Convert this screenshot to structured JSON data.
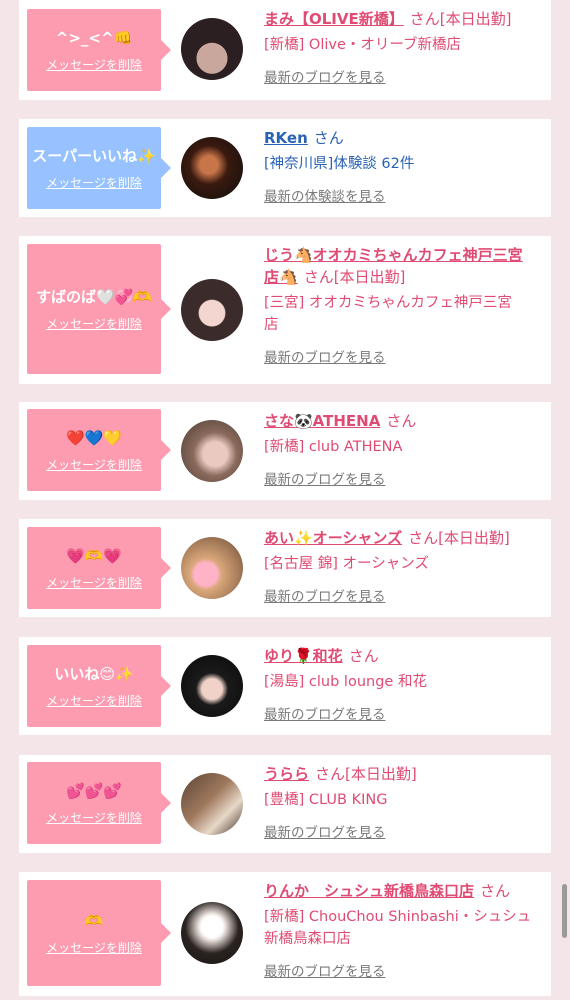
{
  "items": [
    {
      "bubble_text": "^>_<^👊",
      "delete_label": "メッセージを削除",
      "name": "まみ【OLIVE新橋】",
      "suffix": "さん[本日出勤]",
      "shop": "[新橋] Olive・オリーブ新橋店",
      "blog": "最新のブログを見る",
      "bubble_color": "#fd9cb0"
    },
    {
      "bubble_text": "スーパーいいね✨",
      "delete_label": "メッセージを削除",
      "name": "RKen",
      "suffix": "さん",
      "shop": "[神奈川県]体験談 62件",
      "blog": "最新の体験談を見る",
      "bubble_color": "#97c2ff"
    },
    {
      "bubble_text": "すばのば🤍💞🫶",
      "delete_label": "メッセージを削除",
      "name_line1": "じう🐴オオカミちゃんカフェ神戸三宮",
      "name_line2": "店🐴",
      "suffix": "さん[本日出勤]",
      "shop_line1": "[三宮] オオカミちゃんカフェ神戸三宮",
      "shop_line2": "店",
      "blog": "最新のブログを見る",
      "bubble_color": "#fd9cb0"
    },
    {
      "bubble_text": "❤️💙💛",
      "delete_label": "メッセージを削除",
      "name": "さな🐼ATHENA",
      "suffix": "さん",
      "shop": "[新橋] club ATHENA",
      "blog": "最新のブログを見る",
      "bubble_color": "#fd9cb0"
    },
    {
      "bubble_text": "💗🫶💗",
      "delete_label": "メッセージを削除",
      "name": "あい✨オーシャンズ",
      "suffix": "さん[本日出勤]",
      "shop": "[名古屋 錦] オーシャンズ",
      "blog": "最新のブログを見る",
      "bubble_color": "#fd9cb0"
    },
    {
      "bubble_text": "いいね😊✨",
      "delete_label": "メッセージを削除",
      "name": "ゆり🌹和花",
      "suffix": "さん",
      "shop": "[湯島] club lounge 和花",
      "blog": "最新のブログを見る",
      "bubble_color": "#fd9cb0"
    },
    {
      "bubble_text": "💕💕💕",
      "delete_label": "メッセージを削除",
      "name": "うらら",
      "suffix": "さん[本日出勤]",
      "shop": "[豊橋] CLUB KING",
      "blog": "最新のブログを見る",
      "bubble_color": "#fd9cb0"
    },
    {
      "bubble_text": "🫶",
      "delete_label": "メッセージを削除",
      "name": "りんか　シュシュ新橋鳥森口店",
      "suffix": "さん",
      "shop_line1": "[新橋] ChouChou Shinbashi・シュシュ",
      "shop_line2": "新橋鳥森口店",
      "blog": "最新のブログを見る",
      "bubble_color": "#fd9cb0"
    }
  ]
}
